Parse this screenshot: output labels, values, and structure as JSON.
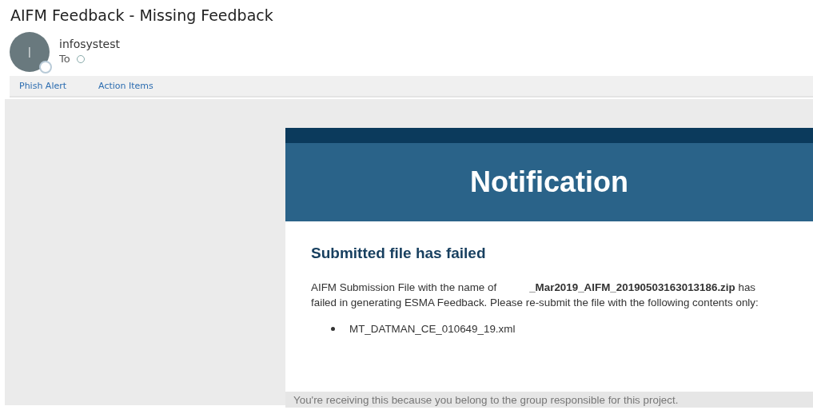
{
  "subject": "AIFM Feedback - Missing Feedback",
  "sender": {
    "avatar_letter": "I",
    "name": "infosystest",
    "to_label": "To"
  },
  "toolbar": [
    "Phish Alert",
    "Action Items"
  ],
  "card": {
    "banner_title": "Notification",
    "heading": "Submitted file has failed",
    "message": "AIFM Submission File with the name of           **_Mar2019_AIFM_20190503163013186.zip** has failed in generating ESMA Feedback. Please re-submit the file with the following contents only:",
    "files": [
      "MT_DATMAN_CE_010649_19.xml"
    ],
    "footer": "You're receiving this because you belong to the group responsible for this project."
  }
}
